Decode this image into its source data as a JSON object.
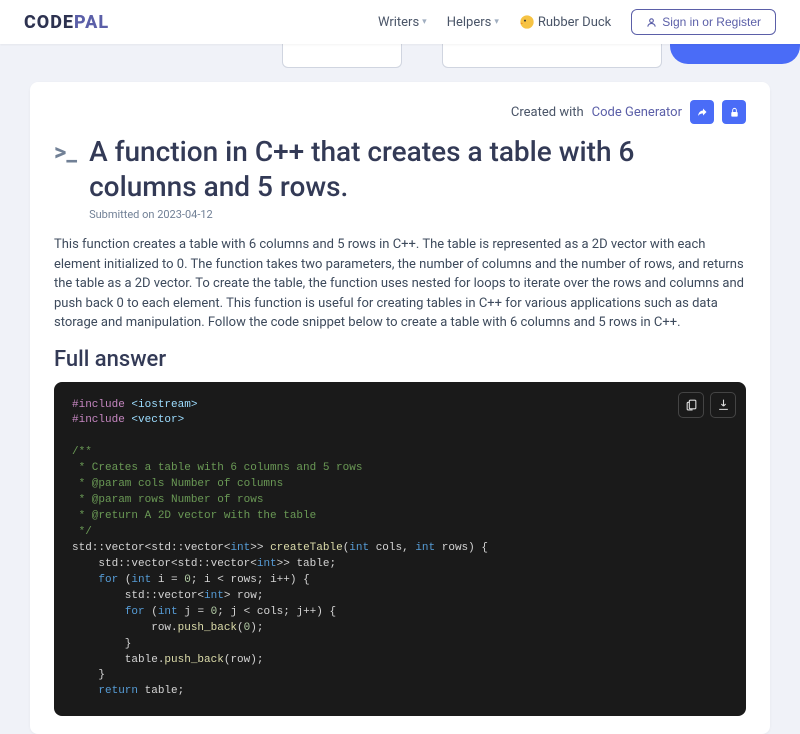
{
  "header": {
    "logo_code": "CODE",
    "logo_pal": "PAL",
    "nav": {
      "writers": "Writers",
      "helpers": "Helpers",
      "rubber_duck": "Rubber Duck"
    },
    "signin": "Sign in or Register"
  },
  "created": {
    "prefix": "Created with",
    "link": "Code Generator"
  },
  "title": "A function in C++ that creates a table with 6 columns and 5 rows.",
  "submitted": "Submitted on 2023-04-12",
  "description": "This function creates a table with 6 columns and 5 rows in C++. The table is represented as a 2D vector with each element initialized to 0. The function takes two parameters, the number of columns and the number of rows, and returns the table as a 2D vector. To create the table, the function uses nested for loops to iterate over the rows and columns and push back 0 to each element. This function is useful for creating tables in C++ for various applications such as data storage and manipulation. Follow the code snippet below to create a table with 6 columns and 5 rows in C++.",
  "section_title": "Full answer",
  "code": {
    "l1a": "#include ",
    "l1b": "<iostream>",
    "l2a": "#include ",
    "l2b": "<vector>",
    "c1": "/**",
    "c2": " * Creates a table with 6 columns and 5 rows",
    "c3": " * @param cols Number of columns",
    "c4": " * @param rows Number of rows",
    "c5": " * @return A 2D vector with the table",
    "c6": " */",
    "sig1": "std::vector<std::vector<",
    "sig2": "int",
    "sig3": ">> ",
    "sig4": "createTable",
    "sig5": "(",
    "sig6": "int",
    "sig7": " cols, ",
    "sig8": "int",
    "sig9": " rows) {",
    "decl1": "    std::vector<std::vector<",
    "decl2": "int",
    "decl3": ">> table;",
    "for1a": "    ",
    "for1b": "for",
    "for1c": " (",
    "for1d": "int",
    "for1e": " i = ",
    "for1f": "0",
    "for1g": "; i < rows; i++) {",
    "row1": "        std::vector<",
    "row2": "int",
    "row3": "> row;",
    "for2a": "        ",
    "for2b": "for",
    "for2c": " (",
    "for2d": "int",
    "for2e": " j = ",
    "for2f": "0",
    "for2g": "; j < cols; j++) {",
    "push1a": "            row.",
    "push1b": "push_back",
    "push1c": "(",
    "push1d": "0",
    "push1e": ");",
    "close1": "        }",
    "push2a": "        table.",
    "push2b": "push_back",
    "push2c": "(row);",
    "close2": "    }",
    "ret1": "    ",
    "ret2": "return",
    "ret3": " table;"
  }
}
